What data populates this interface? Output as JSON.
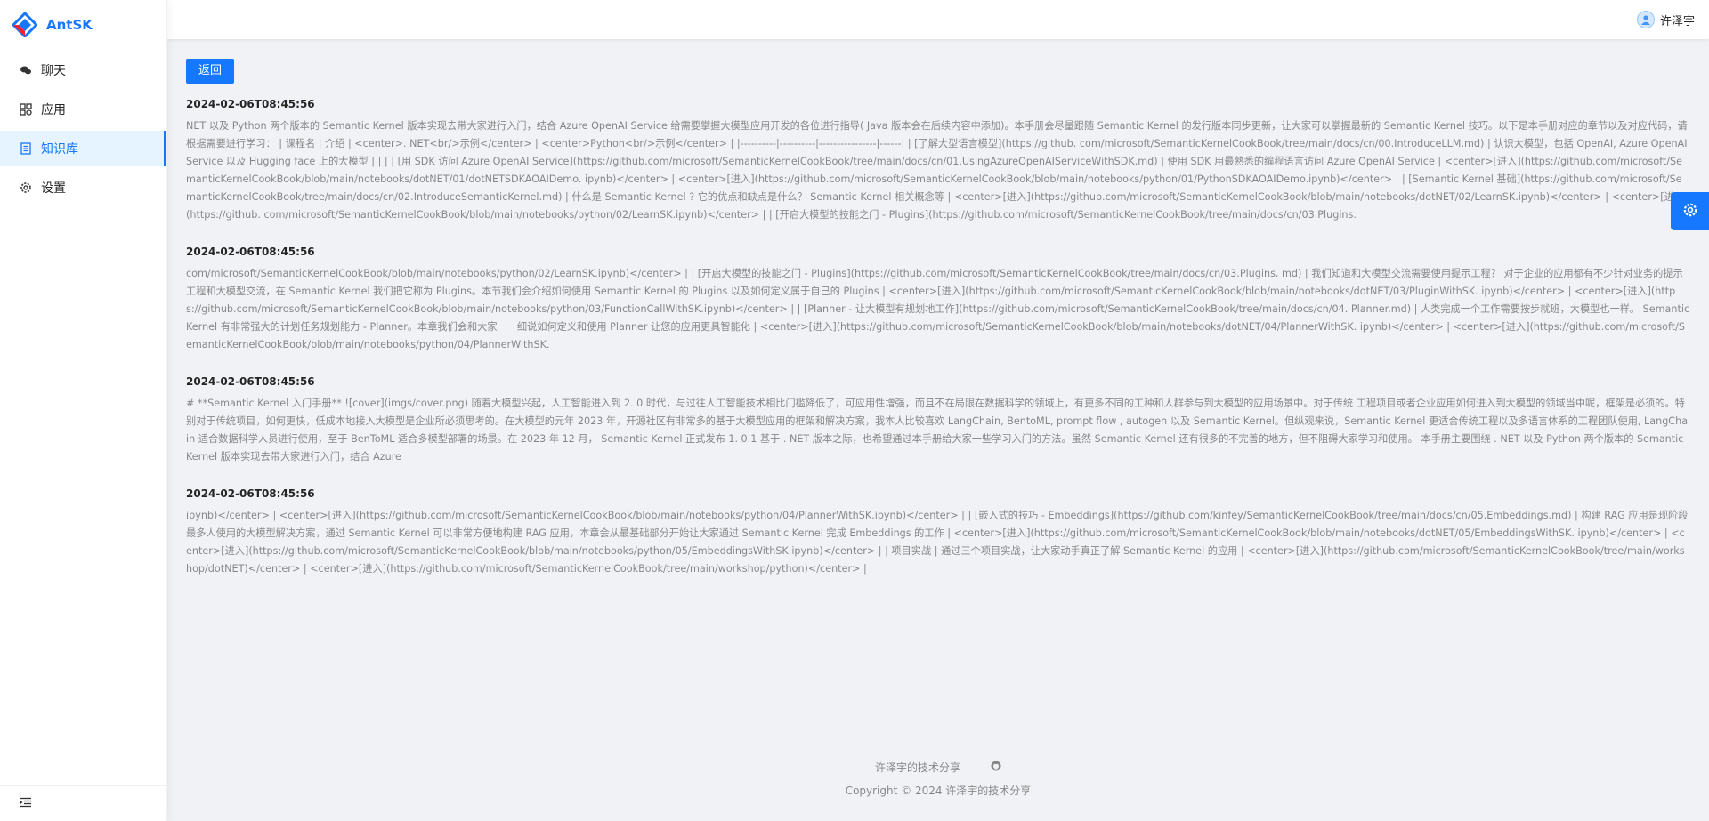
{
  "app": {
    "name": "AntSK",
    "brand_color": "#1677ff"
  },
  "sidebar": {
    "items": [
      {
        "label": "聊天",
        "icon": "chat-icon"
      },
      {
        "label": "应用",
        "icon": "app-icon"
      },
      {
        "label": "知识库",
        "icon": "knowledge-base-icon",
        "active": true
      },
      {
        "label": "设置",
        "icon": "setting-icon"
      }
    ],
    "collapse_icon": "menu-fold-icon"
  },
  "header": {
    "user_name": "许泽宇",
    "avatar_icon": "avatar-icon"
  },
  "content": {
    "back_label": "返回",
    "records": [
      {
        "time": "2024-02-06T08:45:56",
        "text": "NET 以及 Python 两个版本的 Semantic Kernel 版本实现去带大家进行入门，结合 Azure OpenAI Service 给需要掌握大模型应用开发的各位进行指导( Java 版本会在后续内容中添加)。本手册会尽量跟随 Semantic Kernel 的发行版本同步更新，让大家可以掌握最新的 Semantic Kernel 技巧。以下是本手册对应的章节以及对应代码，请根据需要进行学习： | 课程名 | 介绍 | <center>. NET<br/>示例</center> | <center>Python<br/>示例</center> | |----------|----------|----------------|------| | [了解大型语言模型](https://github. com/microsoft/SemanticKernelCookBook/tree/main/docs/cn/00.IntroduceLLM.md) | 认识大模型，包括 OpenAI, Azure OpenAI Service 以及 Hugging face 上的大模型 | | | | [用 SDK 访问 Azure OpenAI Service](https://github.com/microsoft/SemanticKernelCookBook/tree/main/docs/cn/01.UsingAzureOpenAIServiceWithSDK.md) | 使用 SDK 用最熟悉的编程语言访问 Azure OpenAI Service | <center>[进入](https://github.com/microsoft/SemanticKernelCookBook/blob/main/notebooks/dotNET/01/dotNETSDKAOAIDemo. ipynb)</center> | <center>[进入](https://github.com/microsoft/SemanticKernelCookBook/blob/main/notebooks/python/01/PythonSDKAOAIDemo.ipynb)</center> | | [Semantic Kernel 基础](https://github.com/microsoft/SemanticKernelCookBook/tree/main/docs/cn/02.IntroduceSemanticKernel.md) | 什么是 Semantic Kernel ? 它的优点和缺点是什么？ Semantic Kernel 相关概念等 | <center>[进入](https://github.com/microsoft/SemanticKernelCookBook/blob/main/notebooks/dotNET/02/LearnSK.ipynb)</center> | <center>[进入](https://github. com/microsoft/SemanticKernelCookBook/blob/main/notebooks/python/02/LearnSK.ipynb)</center> | | [开启大模型的技能之门 - Plugins](https://github.com/microsoft/SemanticKernelCookBook/tree/main/docs/cn/03.Plugins."
      },
      {
        "time": "2024-02-06T08:45:56",
        "text": "com/microsoft/SemanticKernelCookBook/blob/main/notebooks/python/02/LearnSK.ipynb)</center> | | [开启大模型的技能之门 - Plugins](https://github.com/microsoft/SemanticKernelCookBook/tree/main/docs/cn/03.Plugins. md) | 我们知道和大模型交流需要使用提示工程？ 对于企业的应用都有不少针对业务的提示工程和大模型交流，在 Semantic Kernel 我们把它称为 Plugins。本节我们会介绍如何使用 Semantic Kernel 的 Plugins 以及如何定义属于自己的 Plugins | <center>[进入](https://github.com/microsoft/SemanticKernelCookBook/blob/main/notebooks/dotNET/03/PluginWithSK. ipynb)</center> | <center>[进入](https://github.com/microsoft/SemanticKernelCookBook/blob/main/notebooks/python/03/FunctionCallWithSK.ipynb)</center> | | [Planner - 让大模型有规划地工作](https://github.com/microsoft/SemanticKernelCookBook/tree/main/docs/cn/04. Planner.md) | 人类完成一个工作需要按步就班，大模型也一样。 Semantic Kernel 有非常强大的计划任务规划能力 - Planner。本章我们会和大家一一细说如何定义和使用 Planner 让您的应用更具智能化 | <center>[进入](https://github.com/microsoft/SemanticKernelCookBook/blob/main/notebooks/dotNET/04/PlannerWithSK. ipynb)</center> | <center>[进入](https://github.com/microsoft/SemanticKernelCookBook/blob/main/notebooks/python/04/PlannerWithSK."
      },
      {
        "time": "2024-02-06T08:45:56",
        "text": "# **Semantic Kernel 入门手册** ![cover](imgs/cover.png) 随着大模型兴起，人工智能进入到 2. 0 时代，与过往人工智能技术相比门槛降低了，可应用性增强，而且不在局限在数据科学的领域上，有更多不同的工种和人群参与到大模型的应用场景中。对于传统 工程项目或者企业应用如何进入到大模型的领域当中呢，框架是必须的。特别对于传统项目，如何更快，低成本地接入大模型是企业所必须思考的。在大模型的元年 2023 年，开源社区有非常多的基于大模型应用的框架和解决方案，我本人比较喜欢 LangChain, BentoML, prompt flow , autogen 以及 Semantic Kernel。但纵观来说，Semantic Kernel 更适合传统工程以及多语言体系的工程团队使用, LangChain 适合数据科学人员进行使用，至于 BenToML 适合多模型部署的场景。在 2023 年 12 月， Semantic Kernel 正式发布 1. 0.1 基于 . NET 版本之际，也希望通过本手册给大家一些学习入门的方法。虽然 Semantic Kernel 还有很多的不完善的地方，但不阻碍大家学习和使用。 本手册主要围绕 . NET 以及 Python 两个版本的 Semantic Kernel 版本实现去带大家进行入门，结合 Azure"
      },
      {
        "time": "2024-02-06T08:45:56",
        "text": "ipynb)</center> | <center>[进入](https://github.com/microsoft/SemanticKernelCookBook/blob/main/notebooks/python/04/PlannerWithSK.ipynb)</center> | | [嵌入式的技巧 - Embeddings](https://github.com/kinfey/SemanticKernelCookBook/tree/main/docs/cn/05.Embeddings.md) | 构建 RAG 应用是现阶段最多人使用的大模型解决方案，通过 Semantic Kernel 可以非常方便地构建 RAG 应用，本章会从最基础部分开始让大家通过 Semantic Kernel 完成 Embeddings 的工作 | <center>[进入](https://github.com/microsoft/SemanticKernelCookBook/blob/main/notebooks/dotNET/05/EmbeddingsWithSK. ipynb)</center> | <center>[进入](https://github.com/microsoft/SemanticKernelCookBook/blob/main/notebooks/python/05/EmbeddingsWithSK.ipynb)</center> | | 项目实战 | 通过三个项目实战，让大家动手真正了解 Semantic Kernel 的应用 | <center>[进入](https://github.com/microsoft/SemanticKernelCookBook/tree/main/workshop/dotNET)</center> | <center>[进入](https://github.com/microsoft/SemanticKernelCookBook/tree/main/workshop/python)</center> |"
      }
    ]
  },
  "footer": {
    "link_label": "许泽宇的技术分享",
    "github_icon": "github-icon",
    "copyright": "Copyright © 2024 许泽宇的技术分享"
  },
  "float_button": {
    "icon": "setting-icon"
  }
}
